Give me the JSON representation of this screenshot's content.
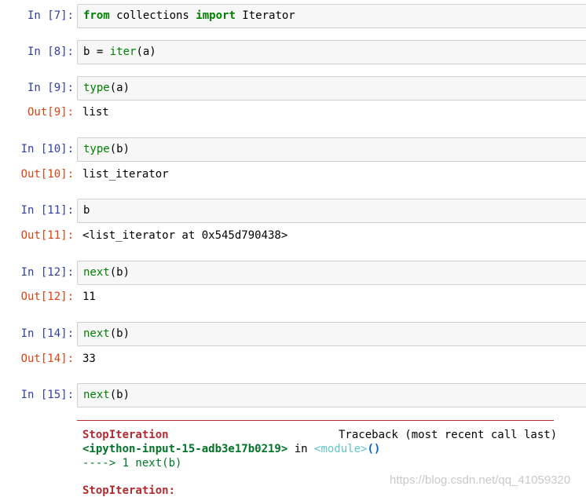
{
  "cells": [
    {
      "in_prompt": "In [7]:",
      "code": [
        "from",
        " collections ",
        "import",
        " Iterator"
      ]
    },
    {
      "in_prompt": "In [8]:",
      "code": [
        "b = ",
        "iter",
        "(a)"
      ]
    },
    {
      "in_prompt": "In [9]:",
      "code": [
        "type",
        "(a)"
      ],
      "out_prompt": "Out[9]:",
      "output": "list"
    },
    {
      "in_prompt": "In [10]:",
      "code": [
        "type",
        "(b)"
      ],
      "out_prompt": "Out[10]:",
      "output": "list_iterator"
    },
    {
      "in_prompt": "In [11]:",
      "code": [
        "b"
      ],
      "out_prompt": "Out[11]:",
      "output": "<list_iterator at 0x545d790438>"
    },
    {
      "in_prompt": "In [12]:",
      "code": [
        "next",
        "(b)"
      ],
      "out_prompt": "Out[12]:",
      "output": "11"
    },
    {
      "in_prompt": "In [14]:",
      "code": [
        "next",
        "(b)"
      ],
      "out_prompt": "Out[14]:",
      "output": "33"
    },
    {
      "in_prompt": "In [15]:",
      "code": [
        "next",
        "(b)"
      ]
    }
  ],
  "traceback": {
    "error_name": "StopIteration",
    "header": "Traceback (most recent call last)",
    "location": "<ipython-input-15-adb3e17b0219>",
    "in_word": " in ",
    "module": "<module>",
    "parens": "()",
    "arrow_line": "----> 1 next(b)",
    "final_error": "StopIteration:"
  },
  "watermark": "https://blog.csdn.net/qq_41059320",
  "colors": {
    "in_prompt": "#303f9f",
    "out_prompt": "#d84315",
    "keyword_green": "#008000",
    "error_red": "#b22b31",
    "input_bg": "#f7f7f7"
  }
}
